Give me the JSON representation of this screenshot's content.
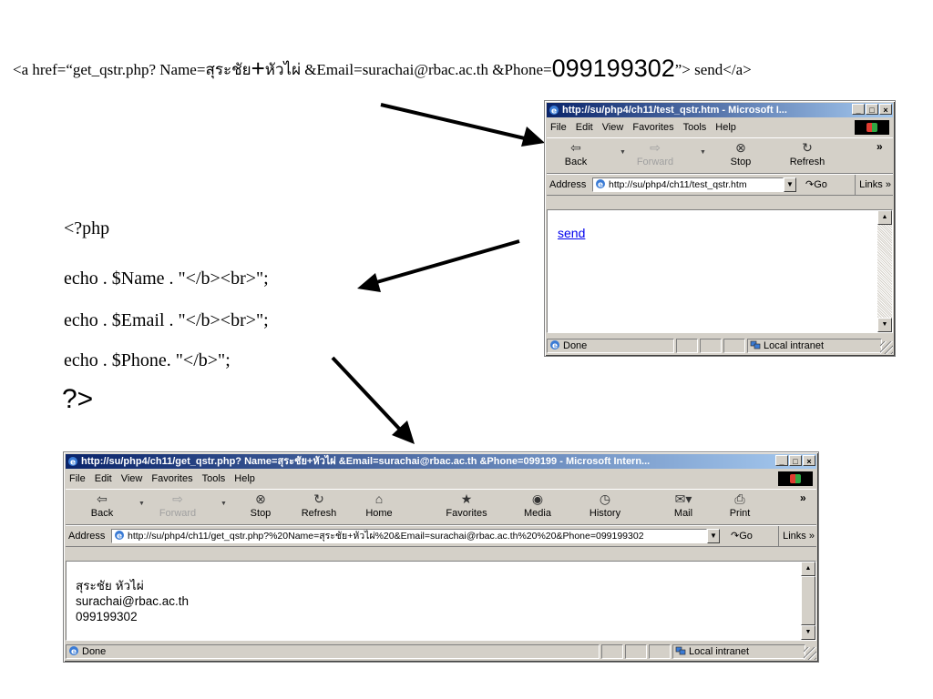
{
  "slide": {
    "code_line_prefix": "<a href=“get_qstr.php? Name=สุระชัย",
    "code_plus": "+",
    "code_mid": "หัวไผ่ &Email=surachai@rbac.ac.th  &Phone=",
    "code_phone": "099199302",
    "code_suffix": "”> send</a>",
    "php_lines": [
      "<?php",
      "echo . $Name . \"</b><br>\";",
      "echo  . $Email . \"</b><br>\";",
      "echo . $Phone. \"</b>\";"
    ],
    "php_close": "?>"
  },
  "colors": {
    "titlebar": "#0a246a",
    "link": "#0000ee",
    "chrome": "#d4d0c8",
    "arrow": "#000000"
  },
  "win1": {
    "title": "http://su/php4/ch11/test_qstr.htm - Microsoft I...",
    "menu": {
      "file": "File",
      "edit": "Edit",
      "view": "View",
      "favorites": "Favorites",
      "tools": "Tools",
      "help": "Help"
    },
    "toolbar": {
      "back": "Back",
      "forward": "Forward",
      "stop": "Stop",
      "refresh": "Refresh"
    },
    "address_label": "Address",
    "address_url": "http://su/php4/ch11/test_qstr.htm",
    "go": "Go",
    "links": "Links",
    "link_text": "send",
    "status_done": "Done",
    "status_zone": "Local intranet"
  },
  "win2": {
    "title": "http://su/php4/ch11/get_qstr.php? Name=สุระชัย+หัวไผ่ &Email=surachai@rbac.ac.th  &Phone=099199 - Microsoft Intern...",
    "menu": {
      "file": "File",
      "edit": "Edit",
      "view": "View",
      "favorites": "Favorites",
      "tools": "Tools",
      "help": "Help"
    },
    "toolbar": {
      "back": "Back",
      "forward": "Forward",
      "stop": "Stop",
      "refresh": "Refresh",
      "home": "Home",
      "favorites": "Favorites",
      "media": "Media",
      "history": "History",
      "mail": "Mail",
      "print": "Print"
    },
    "address_label": "Address",
    "address_url": "http://su/php4/ch11/get_qstr.php?%20Name=สุระชัย+หัวไผ่%20&Email=surachai@rbac.ac.th%20%20&Phone=099199302",
    "go": "Go",
    "links": "Links",
    "output_name": "สุระชัย หัวไผ่",
    "output_email": "surachai@rbac.ac.th",
    "output_phone": "099199302",
    "status_done": "Done",
    "status_zone": "Local intranet"
  }
}
